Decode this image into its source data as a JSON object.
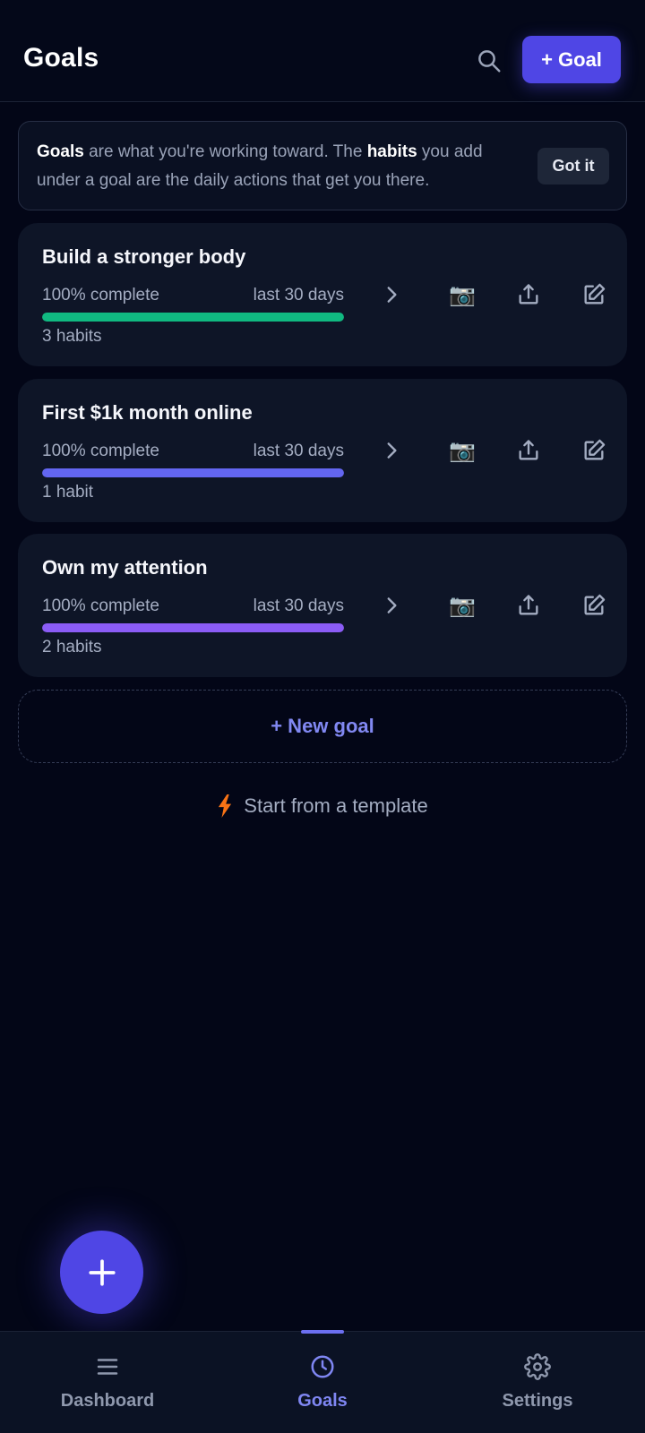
{
  "header": {
    "title": "Goals",
    "add_goal_label": "+ Goal"
  },
  "info_banner": {
    "strong_goals": "Goals",
    "text_1": " are what you're working toward. The ",
    "strong_habits": "habits",
    "text_2": " you add under a goal are the daily actions that get you there.",
    "dismiss_label": "Got it"
  },
  "goals": [
    {
      "title": "Build a stronger body",
      "progress_label": "100% complete",
      "progress": 1.0,
      "period": "last 30 days",
      "habits": "3 habits",
      "color": "#10b981",
      "camera_icon": "📷"
    },
    {
      "title": "First $1k month online",
      "progress_label": "100% complete",
      "progress": 1.0,
      "period": "last 30 days",
      "habits": "1 habit",
      "color": "#6366f1",
      "camera_icon": "📷"
    },
    {
      "title": "Own my attention",
      "progress_label": "100% complete",
      "progress": 1.0,
      "period": "last 30 days",
      "habits": "2 habits",
      "color": "#8b5cf6",
      "camera_icon": "📷"
    }
  ],
  "new_goal_label": "+ New goal",
  "template_label": "Start from a template",
  "bottom_nav": {
    "items": [
      {
        "label": "Dashboard",
        "icon": "menu-icon",
        "active": false
      },
      {
        "label": "Goals",
        "icon": "clock-icon",
        "active": true
      },
      {
        "label": "Settings",
        "icon": "gear-icon",
        "active": false
      }
    ]
  },
  "colors": {
    "accent": "#4f46e5",
    "accent_text": "#8188f2",
    "background": "#030617",
    "card": "#0e1527"
  }
}
